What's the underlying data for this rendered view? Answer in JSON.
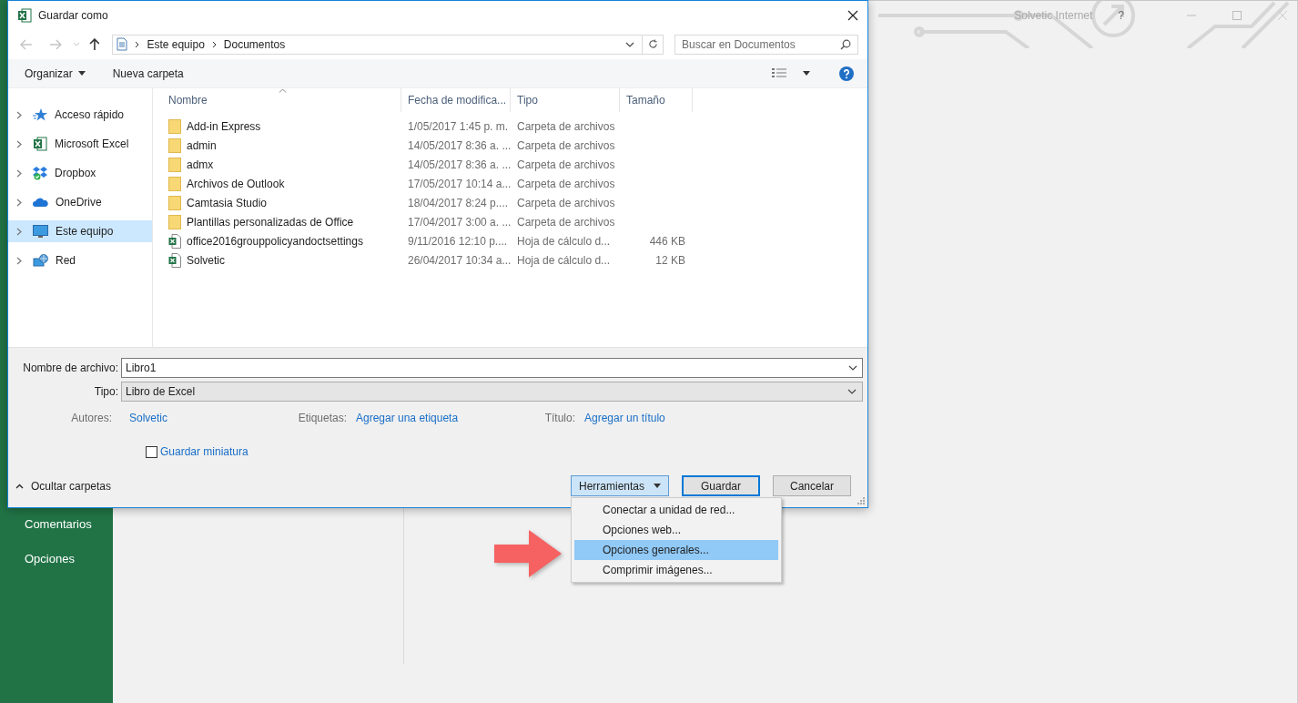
{
  "app": {
    "account": "Solvetic Internet",
    "help": "?",
    "sidebar": [
      {
        "label": "Comentarios"
      },
      {
        "label": "Opciones"
      }
    ]
  },
  "dialog": {
    "title": "Guardar como",
    "navigation": [
      {
        "kind": "back",
        "disabled": true
      },
      {
        "kind": "forward",
        "disabled": true
      },
      {
        "kind": "recent",
        "disabled": true
      },
      {
        "kind": "up",
        "disabled": false
      }
    ],
    "breadcrumb": [
      "Este equipo",
      "Documentos"
    ],
    "search": {
      "placeholder": "Buscar en Documentos"
    },
    "toolbar": {
      "organize": "Organizar",
      "new_folder": "Nueva carpeta"
    },
    "nav_pane": [
      {
        "label": "Acceso rápido",
        "kind": "star",
        "selected": false
      },
      {
        "label": "Microsoft Excel",
        "kind": "excel",
        "selected": false
      },
      {
        "label": "Dropbox",
        "kind": "dropbox",
        "selected": false
      },
      {
        "label": "OneDrive",
        "kind": "cloud",
        "selected": false
      },
      {
        "label": "Este equipo",
        "kind": "computer",
        "selected": true
      },
      {
        "label": "Red",
        "kind": "network",
        "selected": false
      }
    ],
    "columns": [
      "Nombre",
      "Fecha de modifica...",
      "Tipo",
      "Tamaño"
    ],
    "files": [
      {
        "name": "Add-in Express",
        "kind": "folder",
        "date": "1/05/2017 1:45 p. m.",
        "type": "Carpeta de archivos"
      },
      {
        "name": "admin",
        "kind": "folder",
        "date": "14/05/2017 8:36 a. ...",
        "type": "Carpeta de archivos"
      },
      {
        "name": "admx",
        "kind": "folder",
        "date": "14/05/2017 8:36 a. ...",
        "type": "Carpeta de archivos"
      },
      {
        "name": "Archivos de Outlook",
        "kind": "folder",
        "date": "17/05/2017 10:14 a...",
        "type": "Carpeta de archivos"
      },
      {
        "name": "Camtasia Studio",
        "kind": "folder",
        "date": "18/04/2017 8:24 p....",
        "type": "Carpeta de archivos"
      },
      {
        "name": "Plantillas personalizadas de Office",
        "kind": "folder",
        "date": "17/04/2017 3:00 a. ...",
        "type": "Carpeta de archivos"
      },
      {
        "name": "office2016grouppolicyandoctsettings",
        "kind": "excel",
        "date": "9/11/2016 12:10 p....",
        "type": "Hoja de cálculo d...",
        "size": "446 KB"
      },
      {
        "name": "Solvetic",
        "kind": "excel",
        "date": "26/04/2017 10:34 a...",
        "type": "Hoja de cálculo d...",
        "size": "12 KB"
      }
    ],
    "file_name": {
      "label": "Nombre de archivo:",
      "value": "Libro1"
    },
    "file_type": {
      "label": "Tipo:",
      "value": "Libro de Excel"
    },
    "metadata": [
      {
        "label": "Autores:",
        "value": "Solvetic"
      },
      {
        "label": "Etiquetas:",
        "value": "Agregar una etiqueta"
      },
      {
        "label": "Título:",
        "value": "Agregar un título"
      }
    ],
    "thumbnail": {
      "label": "Guardar miniatura",
      "checked": false
    },
    "hide_folders": "Ocultar carpetas",
    "tools": {
      "label": "Herramientas",
      "expanded": true
    },
    "save": "Guardar",
    "cancel": "Cancelar",
    "tools_menu": [
      {
        "label": "Conectar a unidad de red...",
        "selected": false
      },
      {
        "label": "Opciones web...",
        "selected": false
      },
      {
        "label": "Opciones generales...",
        "selected": true
      },
      {
        "label": "Comprimir imágenes...",
        "selected": false
      }
    ]
  }
}
